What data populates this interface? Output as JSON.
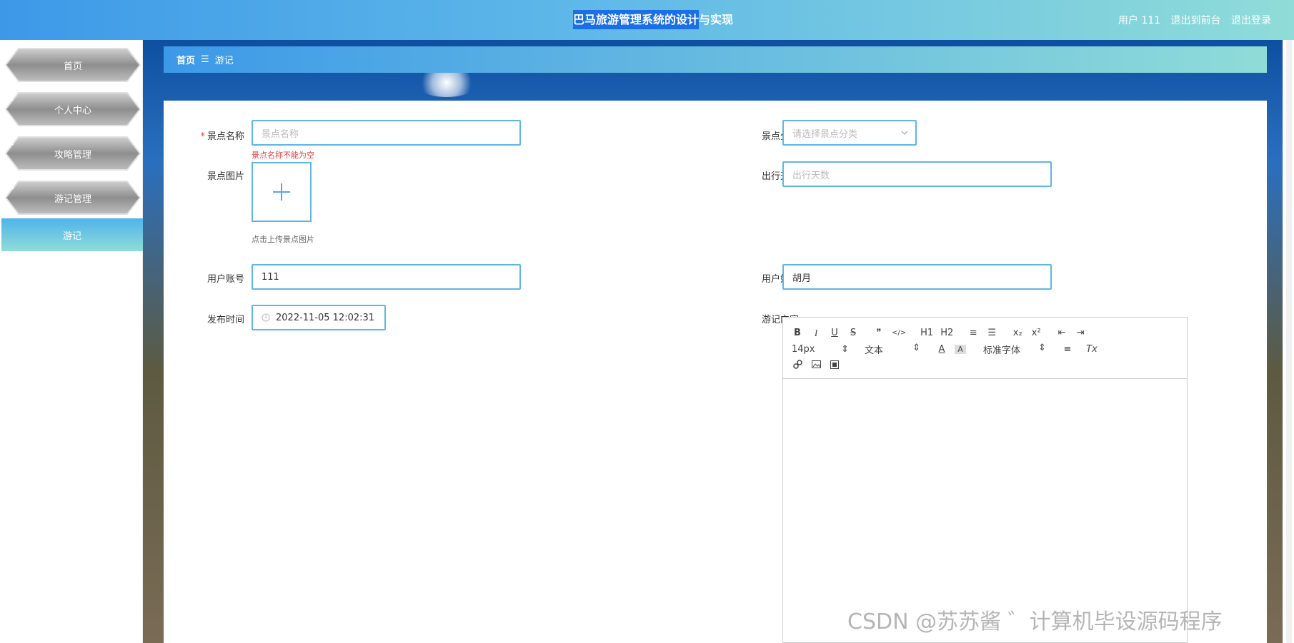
{
  "header": {
    "title_selected": "巴马旅游管理系统的设计",
    "title_rest": "与实现",
    "user_label": "用户 111",
    "to_front_label": "退出到前台",
    "logout_label": "退出登录"
  },
  "sidebar": {
    "items": [
      {
        "label": "首页",
        "icon": "home-icon"
      },
      {
        "label": "个人中心",
        "icon": "user-icon"
      },
      {
        "label": "攻略管理",
        "icon": "user-icon"
      },
      {
        "label": "游记管理",
        "icon": "grid-icon"
      }
    ],
    "sub_item": "游记"
  },
  "breadcrumb": {
    "home": "首页",
    "separator": "☰",
    "current": "游记"
  },
  "form": {
    "spot_name": {
      "label": "景点名称",
      "placeholder": "景点名称",
      "error": "景点名称不能为空"
    },
    "spot_category": {
      "label": "景点分类",
      "placeholder": "请选择景点分类"
    },
    "spot_image": {
      "label": "景点图片",
      "hint": "点击上传景点图片"
    },
    "travel_days": {
      "label": "出行天数",
      "placeholder": "出行天数"
    },
    "user_account": {
      "label": "用户账号",
      "value": "111"
    },
    "user_name": {
      "label": "用户姓名",
      "value": "胡月"
    },
    "publish_time": {
      "label": "发布时间",
      "value": "2022-11-05 12:02:31"
    },
    "content": {
      "label": "游记内容"
    }
  },
  "editor": {
    "row1": [
      "B",
      "I",
      "U",
      "S",
      "❞",
      "</>",
      "H1",
      "H2",
      "≡",
      "☰",
      "x₂",
      "x²",
      "⇤",
      "⇥"
    ],
    "font_size": "14px",
    "text_style": "文本",
    "text_color": "A",
    "bg_color": "A",
    "font_family": "标准字体",
    "align": "≡",
    "clear_format": "Tx"
  },
  "watermark": "CSDN @苏苏酱 ゛计算机毕设源码程序"
}
